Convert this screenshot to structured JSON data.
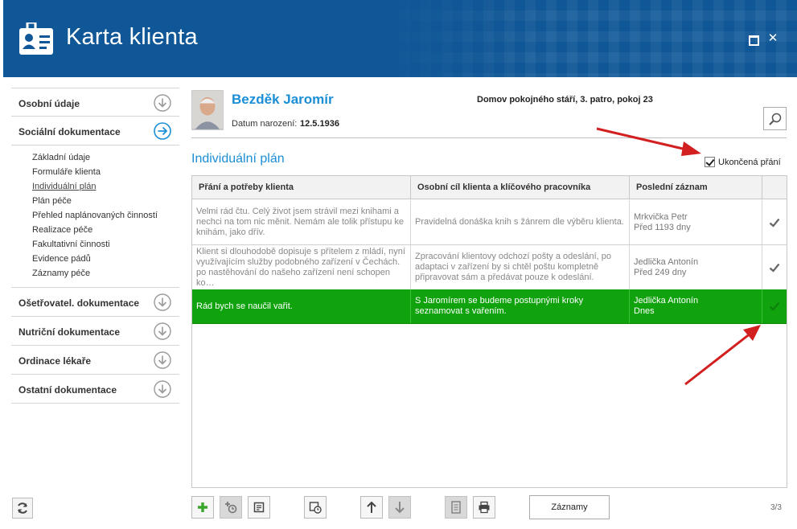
{
  "window": {
    "title": "Karta klienta",
    "maximize_label": "",
    "close_label": "✕"
  },
  "sidebar": {
    "sections": [
      {
        "label": "Osobní údaje",
        "icon": "chevron-down-circle-icon"
      },
      {
        "label": "Sociální dokumentace",
        "icon": "arrow-right-circle-icon"
      },
      {
        "label": "Ošetřovatel. dokumentace",
        "icon": "chevron-down-circle-icon"
      },
      {
        "label": "Nutriční dokumentace",
        "icon": "chevron-down-circle-icon"
      },
      {
        "label": "Ordinace lékaře",
        "icon": "chevron-down-circle-icon"
      },
      {
        "label": "Ostatní dokumentace",
        "icon": "chevron-down-circle-icon"
      }
    ],
    "social_items": [
      "Základní údaje",
      "Formuláře klienta",
      "Individuální plán",
      "Plán péče",
      "Přehled naplánovaných činností",
      "Realizace péče",
      "Fakultativní činnosti",
      "Evidence pádů",
      "Záznamy péče"
    ],
    "active_item": "Individuální plán"
  },
  "client": {
    "name": "Bezděk Jaromír",
    "birth_label": "Datum narození:",
    "birth_date": "12.5.1936",
    "location": "Domov pokojného stáří, 3. patro, pokoj 23"
  },
  "plan": {
    "title": "Individuální plán",
    "completed_label": "Ukončená přání",
    "completed_checked": true
  },
  "table": {
    "headers": [
      "Přání a potřeby klienta",
      "Osobní cíl klienta a klíčového pracovníka",
      "Poslední záznam",
      ""
    ],
    "rows": [
      {
        "wish": "Velmi rád čtu. Celý život jsem strávil mezi knihami a nechci na tom nic měnit. Nemám ale tolik přístupu ke knihám, jako dřív.",
        "goal": "Pravidelná donáška knih s žánrem dle výběru klienta.",
        "last_name": "Mrkvička Petr",
        "last_time": "Před 1193 dny",
        "selected": false
      },
      {
        "wish": "Klient si dlouhodobě dopisuje s přítelem z mládí, nyní využívajícím služby podobného zařízení v Čechách. po nastěhování do našeho zařízení není schopen ko…",
        "goal": "Zpracování klientovy odchozí pošty a odeslání, po adaptaci v zařízení by si chtěl poštu kompletně připravovat sám a předávat pouze k odeslání.",
        "last_name": "Jedlička Antonín",
        "last_time": "Před 249 dny",
        "selected": false
      },
      {
        "wish": "Rád bych se naučil vařit.",
        "goal": "S Jaromírem se budeme postupnými kroky seznamovat s vařením.",
        "last_name": "Jedlička Antonín",
        "last_time": "Dnes",
        "selected": true
      }
    ]
  },
  "toolbar": {
    "records_label": "Záznamy",
    "pager": "3/3"
  },
  "colors": {
    "header_bg": "#0f5796",
    "accent_blue": "#1a8ed6",
    "selected_row": "#10a30e",
    "annotation_arrow": "#d21f1f"
  }
}
